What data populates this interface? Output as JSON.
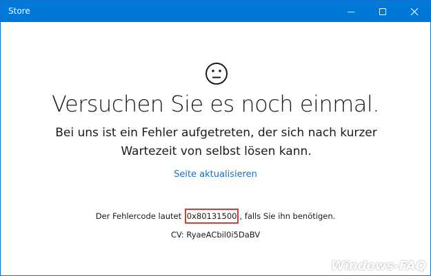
{
  "window": {
    "title": "Store",
    "controls": {
      "minimize_icon": "minimize-icon",
      "maximize_icon": "maximize-icon",
      "close_icon": "close-icon"
    },
    "accent_color": "#0078d7"
  },
  "main": {
    "icon": "neutral-face-icon",
    "headline": "Versuchen Sie es noch einmal.",
    "description": "Bei uns ist ein Fehler aufgetreten, der sich nach kurzer Wartezeit von selbst lösen kann.",
    "refresh_link": "Seite aktualisieren",
    "error_prefix": "Der Fehlercode lautet",
    "error_code": "0x80131500",
    "error_suffix": ", falls Sie ihn benötigen.",
    "cv": "CV: RyaeACbil0i5DaBV",
    "link_color": "#1b6fc2",
    "highlight_color": "#e0363a"
  },
  "watermark": "Windows-FAQ"
}
